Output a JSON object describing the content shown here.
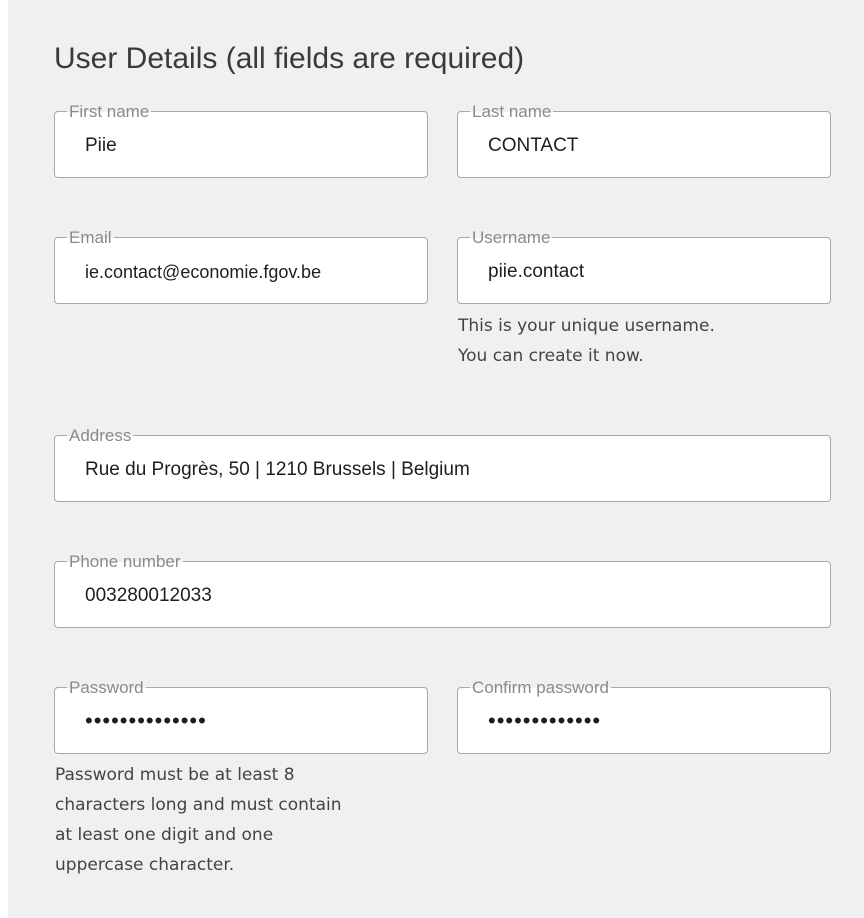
{
  "form": {
    "title": "User Details (all fields are required)",
    "first_name": {
      "label": "First name",
      "value": "Piie"
    },
    "last_name": {
      "label": "Last name",
      "value": "CONTACT"
    },
    "email": {
      "label": "Email",
      "value": "ie.contact@economie.fgov.be"
    },
    "username": {
      "label": "Username",
      "value": "piie.contact",
      "help_line1": "This is your unique username.",
      "help_line2": "You can create it now."
    },
    "address": {
      "label": "Address",
      "value": "Rue du Progrès, 50 | 1210 Brussels | Belgium"
    },
    "phone": {
      "label": "Phone number",
      "value": "003280012033"
    },
    "password": {
      "label": "Password",
      "value": "••••••••••••••",
      "help_line1": "Password must be at least 8",
      "help_line2": "characters long and must contain",
      "help_line3": "at least one digit and one",
      "help_line4": "uppercase character."
    },
    "confirm_password": {
      "label": "Confirm password",
      "value": "•••••••••••••"
    }
  }
}
